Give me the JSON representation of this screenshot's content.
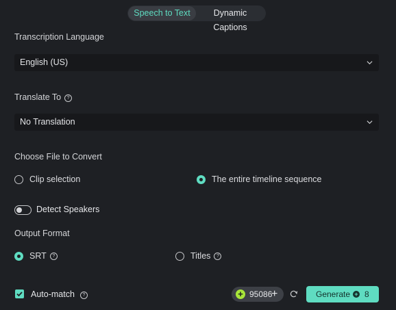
{
  "tabs": [
    {
      "label": "Speech to Text",
      "active": true
    },
    {
      "label": "Dynamic Captions",
      "active": false
    }
  ],
  "transcription": {
    "label": "Transcription Language",
    "value": "English (US)"
  },
  "translate": {
    "label": "Translate To",
    "value": "No Translation"
  },
  "file": {
    "label": "Choose File to Convert",
    "options": [
      {
        "label": "Clip selection",
        "selected": false
      },
      {
        "label": "The entire timeline sequence",
        "selected": true
      }
    ]
  },
  "detect_speakers": {
    "label": "Detect Speakers",
    "enabled": false
  },
  "output": {
    "label": "Output Format",
    "options": [
      {
        "label": "SRT",
        "selected": true
      },
      {
        "label": "Titles",
        "selected": false
      }
    ]
  },
  "auto_match": {
    "label": "Auto-match",
    "checked": true
  },
  "credits": {
    "value": "95086"
  },
  "generate": {
    "label": "Generate",
    "cost": "8"
  },
  "colors": {
    "accent": "#5fdcc1",
    "background": "#1e2024",
    "field": "#17181b",
    "credit_icon": "#a8e639"
  }
}
